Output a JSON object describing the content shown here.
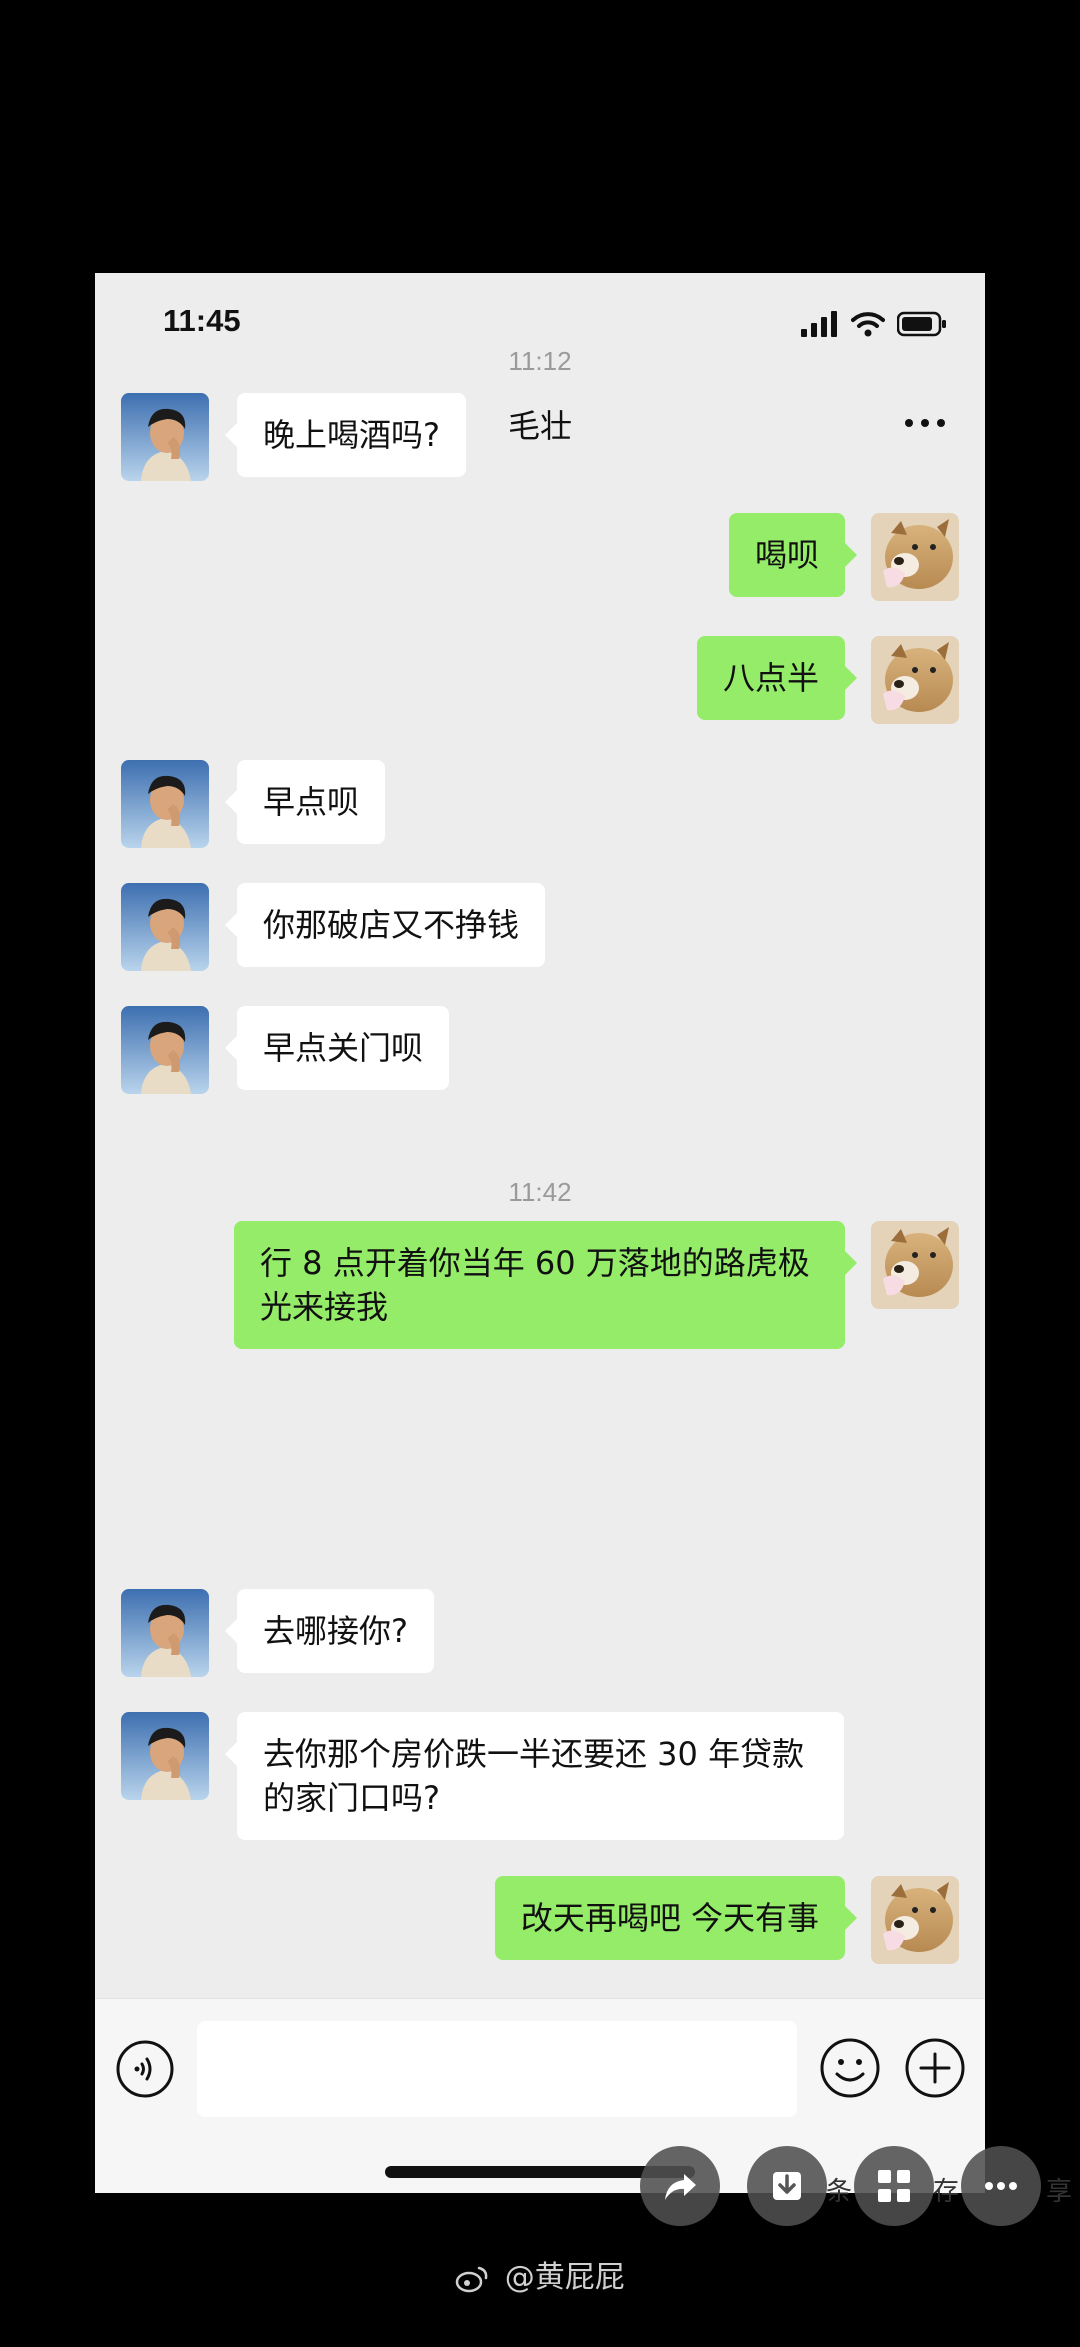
{
  "status_bar": {
    "time": "11:45"
  },
  "header": {
    "title": "毛壮"
  },
  "messages": [
    {
      "type": "timestamp",
      "text": "11:12"
    },
    {
      "type": "in",
      "text": "晚上喝酒吗?"
    },
    {
      "type": "out",
      "text": "喝呗"
    },
    {
      "type": "out",
      "text": "八点半"
    },
    {
      "type": "in",
      "text": "早点呗"
    },
    {
      "type": "in",
      "text": "你那破店又不挣钱"
    },
    {
      "type": "in",
      "text": "早点关门呗"
    },
    {
      "type": "timestamp",
      "text": "11:42"
    },
    {
      "type": "out",
      "text": "行 8 点开着你当年 60 万落地的路虎极光来接我"
    },
    {
      "type": "in",
      "text": "去哪接你?"
    },
    {
      "type": "in",
      "text": "去你那个房价跌一半还要还 30 年贷款的家门口吗?"
    },
    {
      "type": "out",
      "text": "改天再喝吧 今天有事"
    }
  ],
  "input_bar": {
    "value": ""
  },
  "overlay": {
    "label_left": "条",
    "label_mid": "存",
    "label_right": "享"
  },
  "watermark": {
    "text": "@黄屁屁"
  },
  "colors": {
    "outgoing_bubble": "#95ec69",
    "incoming_bubble": "#ffffff",
    "chat_background": "#ededed"
  }
}
